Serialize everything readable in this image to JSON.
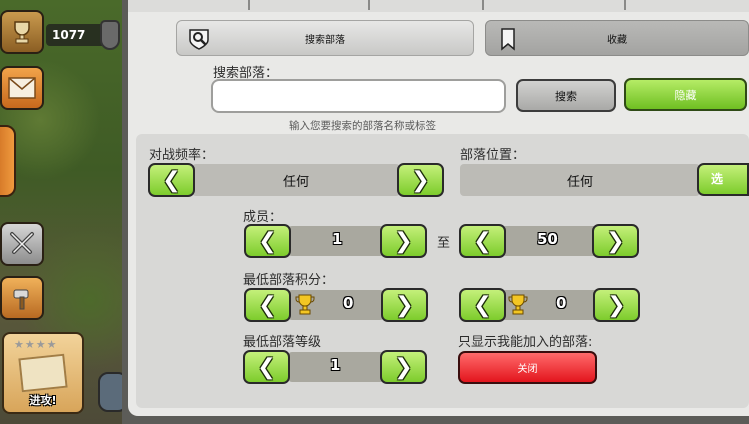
{
  "hud": {
    "trophy_count": "1077",
    "attack_label": "进攻!",
    "stars": "★★★★"
  },
  "tabs": {
    "search": "搜索部落",
    "favorites": "收藏"
  },
  "search": {
    "label": "搜索部落：",
    "input_value": "",
    "search_button": "搜索",
    "hide_button": "隐藏",
    "hint": "输入您要搜索的部落名称或标签"
  },
  "war_frequency": {
    "label": "对战频率：",
    "value": "任何"
  },
  "location": {
    "label": "部落位置：",
    "value": "任何",
    "side_button": "选"
  },
  "members": {
    "label": "成员：",
    "min": "1",
    "to": "至",
    "max": "50"
  },
  "min_points": {
    "label": "最低部落积分：",
    "value": "0",
    "value2": "0"
  },
  "min_level": {
    "label": "最低部落等级",
    "value": "1"
  },
  "joinable_only": {
    "label": "只显示我能加入的部落:",
    "toggle": "关闭"
  },
  "arrows": {
    "left": "❮",
    "right": "❯"
  },
  "colors": {
    "green_button": "#7dcc2c",
    "red_button": "#e3151d",
    "panel": "#e9e9e7"
  }
}
